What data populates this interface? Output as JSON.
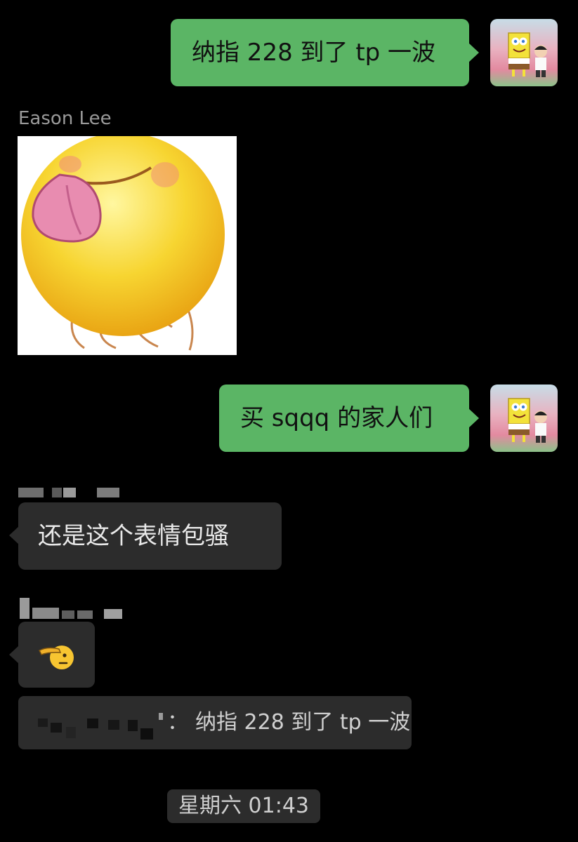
{
  "messages": [
    {
      "id": "m1",
      "direction": "outgoing",
      "text": "纳指 228 到了 tp 一波"
    },
    {
      "id": "m2",
      "direction": "incoming",
      "sender": "Eason Lee",
      "sticker": "tongue-out-emoji-sticker"
    },
    {
      "id": "m3",
      "direction": "outgoing",
      "text": "买 sqqq 的家人们"
    },
    {
      "id": "m4",
      "direction": "incoming",
      "sender": "",
      "text": "还是这个表情包骚"
    },
    {
      "id": "m5",
      "direction": "incoming",
      "sender": "",
      "emoji": "🫡"
    }
  ],
  "quote": {
    "text": "纳指 228 到了 tp 一波",
    "separator": "："
  },
  "timestamp": "星期六 01:43",
  "colors": {
    "background": "#000000",
    "outgoing_bubble": "#5bb565",
    "incoming_bubble": "#2c2c2c",
    "sender_name": "#9a9a9a"
  },
  "icons": {
    "avatar": "spongebob-avatar-icon",
    "sticker": "tongue-out-emoji-sticker"
  }
}
